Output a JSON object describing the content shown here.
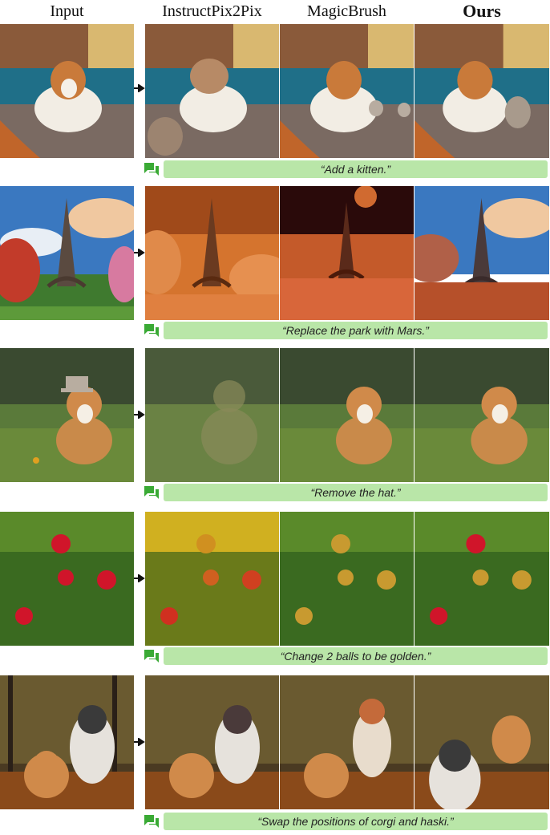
{
  "headers": {
    "input": "Input",
    "instructpix2pix": "InstructPix2Pix",
    "magicbrush": "MagicBrush",
    "ours": "Ours"
  },
  "rows": [
    {
      "caption": "“Add a kitten.”",
      "scene": "dog on sofa"
    },
    {
      "caption": "“Replace the park with Mars.”",
      "scene": "eiffel tower"
    },
    {
      "caption": "“Remove the hat.”",
      "scene": "corgi in grass"
    },
    {
      "caption": "“Change 2 balls to be golden.”",
      "scene": "balls in grass"
    },
    {
      "caption": "“Swap the positions of corgi and haski.”",
      "scene": "dogs in forest"
    }
  ],
  "colors": {
    "caption_bg": "#b9e6a8",
    "chat_icon": "#3aaa35"
  }
}
